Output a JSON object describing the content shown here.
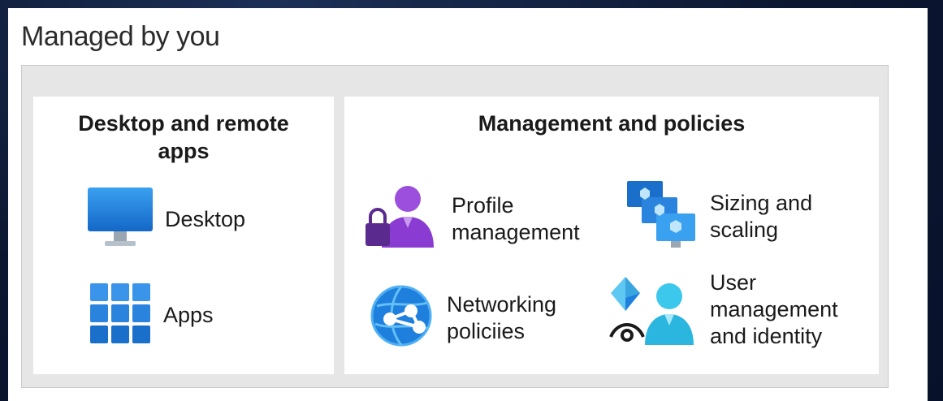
{
  "panel": {
    "title": "Managed by you"
  },
  "desktop_card": {
    "title": "Desktop and remote apps",
    "items": [
      {
        "label": "Desktop",
        "icon": "monitor-icon"
      },
      {
        "label": "Apps",
        "icon": "apps-grid-icon"
      }
    ]
  },
  "management_card": {
    "title": "Management and policies",
    "items": [
      {
        "label_line1": "Profile",
        "label_line2": "management",
        "icon": "profile-lock-icon"
      },
      {
        "label_line1": "Sizing and",
        "label_line2": "scaling",
        "icon": "scaling-monitors-icon"
      },
      {
        "label_line1": "Networking",
        "label_line2": "policiies",
        "icon": "network-globe-icon"
      },
      {
        "label_line1": "User",
        "label_line2": "management",
        "label_line3": "and identity",
        "icon": "user-identity-icon"
      }
    ]
  },
  "colors": {
    "accent_blue": "#1f7fdd",
    "accent_purple": "#8a3bd1",
    "accent_cyan": "#3cc8ec"
  }
}
